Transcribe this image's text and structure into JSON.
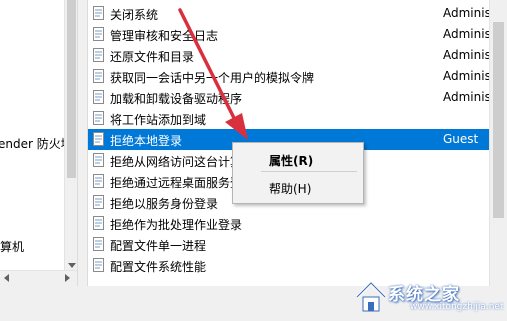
{
  "tree": {
    "items": [
      {
        "label": "ender 防火墙"
      },
      {
        "label": "算机"
      }
    ]
  },
  "policy_list": {
    "rows": [
      {
        "name": "关闭系统",
        "setting": "Administrat",
        "selected": false
      },
      {
        "name": "管理审核和安全日志",
        "setting": "Administrat",
        "selected": false
      },
      {
        "name": "还原文件和目录",
        "setting": "Administrat",
        "selected": false
      },
      {
        "name": "获取同一会话中另一个用户的模拟令牌",
        "setting": "Administrat",
        "selected": false
      },
      {
        "name": "加载和卸载设备驱动程序",
        "setting": "Administrat",
        "selected": false
      },
      {
        "name": "将工作站添加到域",
        "setting": "",
        "selected": false
      },
      {
        "name": "拒绝本地登录",
        "setting": "Guest",
        "selected": true
      },
      {
        "name": "拒绝从网络访问这台计算机",
        "setting": "",
        "selected": false
      },
      {
        "name": "拒绝通过远程桌面服务登录",
        "setting": "",
        "selected": false
      },
      {
        "name": "拒绝以服务身份登录",
        "setting": "",
        "selected": false
      },
      {
        "name": "拒绝作为批处理作业登录",
        "setting": "",
        "selected": false
      },
      {
        "name": "配置文件单一进程",
        "setting": "",
        "selected": false
      },
      {
        "name": "配置文件系统性能",
        "setting": "",
        "selected": false
      }
    ]
  },
  "context_menu": {
    "properties_label": "属性(R)",
    "help_label": "帮助(H)"
  },
  "watermark": {
    "text": "系统之家",
    "url": "www.xitongzhijia.net"
  },
  "colors": {
    "selection": "#0078d7",
    "annotation_arrow": "#d9303e",
    "watermark_accent": "#3a6dbd"
  }
}
